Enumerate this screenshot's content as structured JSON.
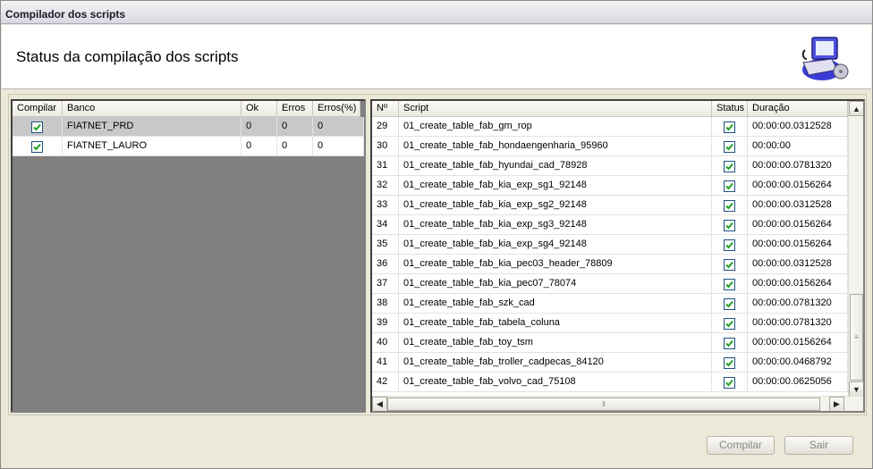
{
  "window": {
    "title": "Compilador dos scripts"
  },
  "header": {
    "title": "Status da compilação dos scripts",
    "logo_icon": "computer-cd-icon"
  },
  "left_grid": {
    "columns": [
      "Compilar",
      "Banco",
      "Ok",
      "Erros",
      "Erros(%)"
    ],
    "rows": [
      {
        "compilar": true,
        "banco": "FIATNET_PRD",
        "ok": "0",
        "erros": "0",
        "erros_pct": "0"
      },
      {
        "compilar": true,
        "banco": "FIATNET_LAURO",
        "ok": "0",
        "erros": "0",
        "erros_pct": "0"
      }
    ]
  },
  "right_grid": {
    "columns": [
      "Nº",
      "Script",
      "Status",
      "Duração"
    ],
    "rows": [
      {
        "n": "29",
        "script": "01_create_table_fab_gm_rop",
        "status": true,
        "duracao": "00:00:00.0312528"
      },
      {
        "n": "30",
        "script": "01_create_table_fab_hondaengenharia_95960",
        "status": true,
        "duracao": "00:00:00"
      },
      {
        "n": "31",
        "script": "01_create_table_fab_hyundai_cad_78928",
        "status": true,
        "duracao": "00:00:00.0781320"
      },
      {
        "n": "32",
        "script": "01_create_table_fab_kia_exp_sg1_92148",
        "status": true,
        "duracao": "00:00:00.0156264"
      },
      {
        "n": "33",
        "script": "01_create_table_fab_kia_exp_sg2_92148",
        "status": true,
        "duracao": "00:00:00.0312528"
      },
      {
        "n": "34",
        "script": "01_create_table_fab_kia_exp_sg3_92148",
        "status": true,
        "duracao": "00:00:00.0156264"
      },
      {
        "n": "35",
        "script": "01_create_table_fab_kia_exp_sg4_92148",
        "status": true,
        "duracao": "00:00:00.0156264"
      },
      {
        "n": "36",
        "script": "01_create_table_fab_kia_pec03_header_78809",
        "status": true,
        "duracao": "00:00:00.0312528"
      },
      {
        "n": "37",
        "script": "01_create_table_fab_kia_pec07_78074",
        "status": true,
        "duracao": "00:00:00.0156264"
      },
      {
        "n": "38",
        "script": "01_create_table_fab_szk_cad",
        "status": true,
        "duracao": "00:00:00.0781320"
      },
      {
        "n": "39",
        "script": "01_create_table_fab_tabela_coluna",
        "status": true,
        "duracao": "00:00:00.0781320"
      },
      {
        "n": "40",
        "script": "01_create_table_fab_toy_tsm",
        "status": true,
        "duracao": "00:00:00.0156264"
      },
      {
        "n": "41",
        "script": "01_create_table_fab_troller_cadpecas_84120",
        "status": true,
        "duracao": "00:00:00.0468792"
      },
      {
        "n": "42",
        "script": "01_create_table_fab_volvo_cad_75108",
        "status": true,
        "duracao": "00:00:00.0625056"
      }
    ]
  },
  "buttons": {
    "compilar": "Compilar",
    "sair": "Sair"
  },
  "colors": {
    "selected_row": "#c8c8c8",
    "grid_empty": "#808080",
    "check": "#21a121"
  }
}
